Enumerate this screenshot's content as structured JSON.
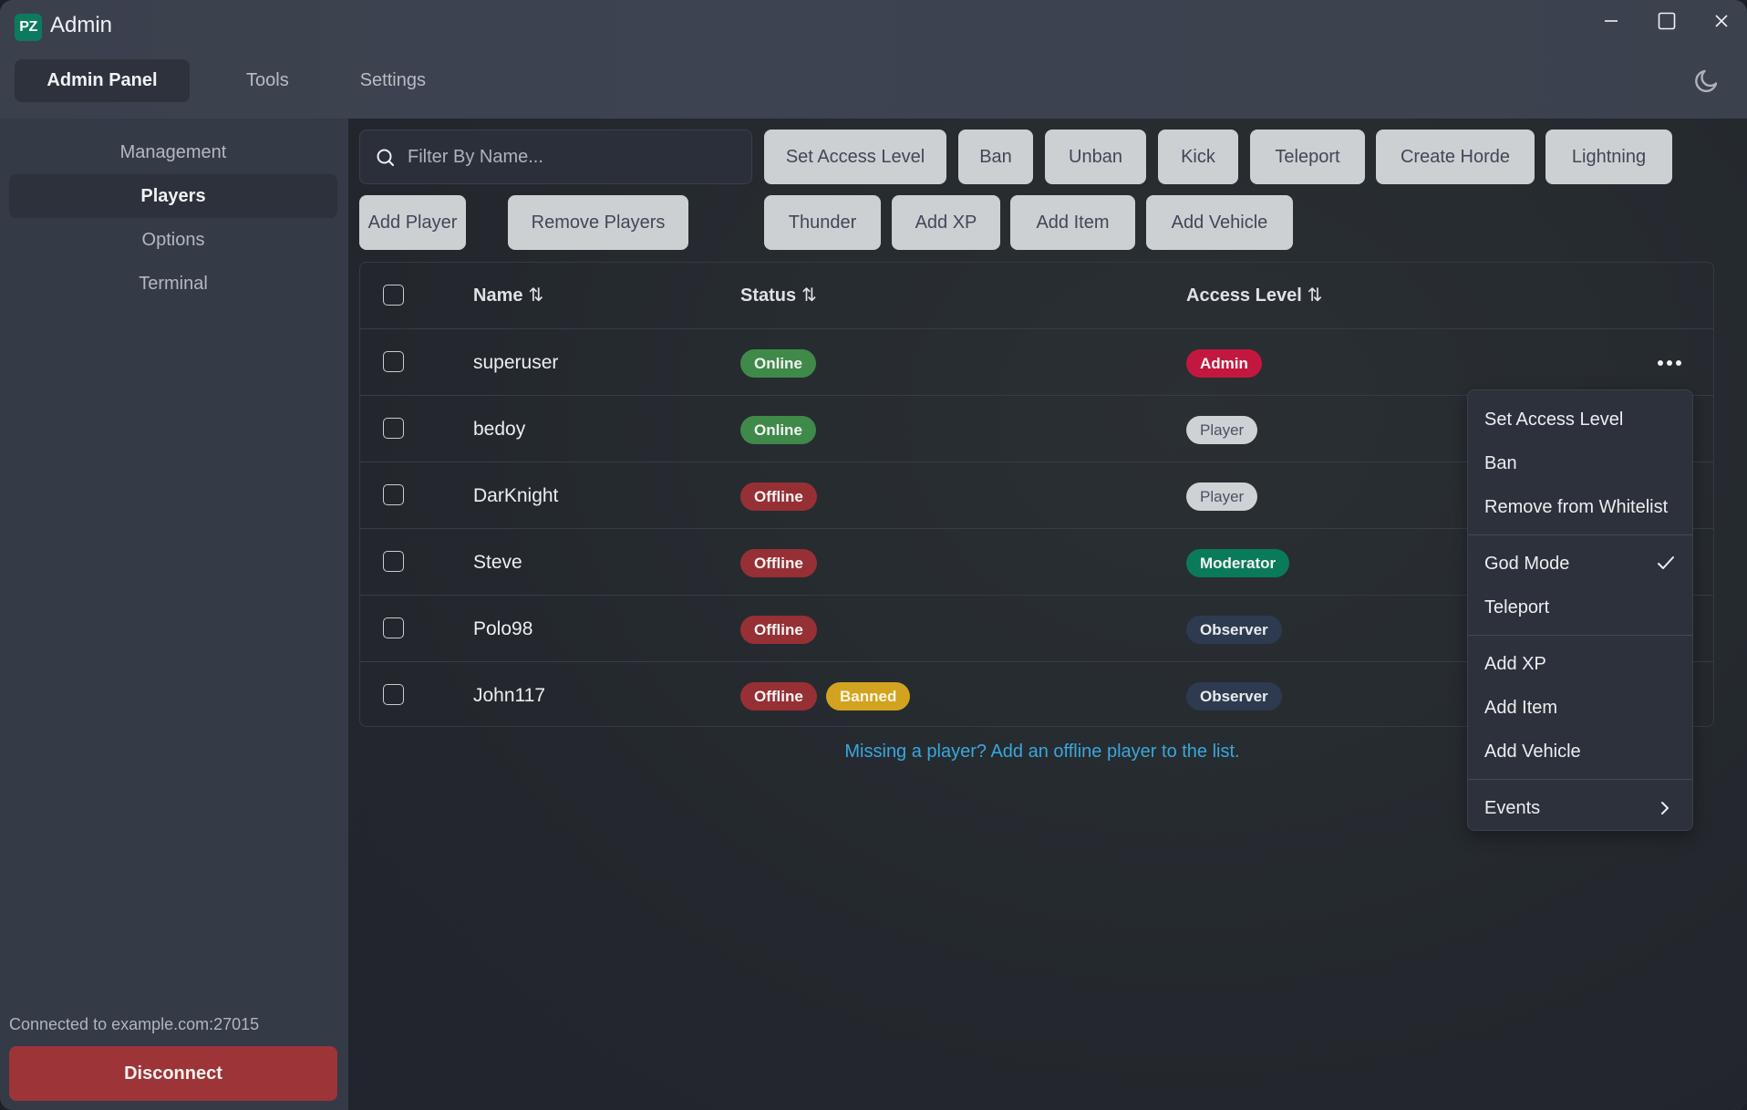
{
  "app": {
    "logo_text": "PZ",
    "title": "Admin"
  },
  "window_controls": {
    "minimize": "minimize-icon",
    "maximize": "maximize-icon",
    "close": "close-icon"
  },
  "tabs": [
    {
      "label": "Admin Panel",
      "active": true
    },
    {
      "label": "Tools",
      "active": false
    },
    {
      "label": "Settings",
      "active": false
    }
  ],
  "theme_toggle": {
    "icon": "moon-icon"
  },
  "sidebar": {
    "heading": "Management",
    "items": [
      {
        "label": "Players",
        "active": true
      },
      {
        "label": "Options",
        "active": false
      },
      {
        "label": "Terminal",
        "active": false
      }
    ],
    "connection_status": "Connected to example.com:27015",
    "disconnect_label": "Disconnect"
  },
  "search": {
    "placeholder": "Filter By Name...",
    "value": ""
  },
  "actions_row1": [
    "Set Access Level",
    "Ban",
    "Unban",
    "Kick",
    "Teleport",
    "Create Horde",
    "Lightning"
  ],
  "actions_left_row2": [
    "Add Player",
    "Remove Players"
  ],
  "actions_row2": [
    "Thunder",
    "Add XP",
    "Add Item",
    "Add Vehicle"
  ],
  "table": {
    "columns": [
      {
        "label": "Name",
        "sort_icon": "⇅"
      },
      {
        "label": "Status",
        "sort_icon": "⇅"
      },
      {
        "label": "Access Level",
        "sort_icon": "⇅"
      }
    ],
    "rows": [
      {
        "name": "superuser",
        "status": [
          "Online"
        ],
        "access": "Admin"
      },
      {
        "name": "bedoy",
        "status": [
          "Online"
        ],
        "access": "Player"
      },
      {
        "name": "DarKnight",
        "status": [
          "Offline"
        ],
        "access": "Player"
      },
      {
        "name": "Steve",
        "status": [
          "Offline"
        ],
        "access": "Moderator"
      },
      {
        "name": "Polo98",
        "status": [
          "Offline"
        ],
        "access": "Observer"
      },
      {
        "name": "John117",
        "status": [
          "Offline",
          "Banned"
        ],
        "access": "Observer"
      }
    ]
  },
  "hint_link": "Missing a player? Add an offline player to the list.",
  "context_menu": {
    "groups": [
      [
        {
          "label": "Set Access Level"
        },
        {
          "label": "Ban"
        },
        {
          "label": "Remove from Whitelist"
        }
      ],
      [
        {
          "label": "God Mode",
          "checked": true
        },
        {
          "label": "Teleport"
        }
      ],
      [
        {
          "label": "Add XP"
        },
        {
          "label": "Add Item"
        },
        {
          "label": "Add Vehicle"
        }
      ],
      [
        {
          "label": "Events",
          "submenu": true
        }
      ]
    ]
  },
  "colors": {
    "online": "#3f8a48",
    "offline": "#963034",
    "banned": "#d2a321",
    "admin": "#c2183f",
    "player": "#cfd2d5",
    "moderator": "#0a7b5a",
    "observer": "#2e3a4f",
    "link": "#3aa7dc",
    "disconnect": "#9c3438",
    "logo": "#0d7a5f"
  }
}
